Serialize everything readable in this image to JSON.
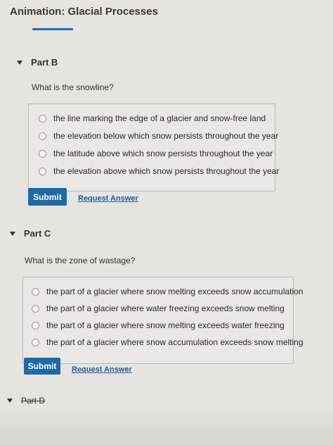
{
  "app": {
    "title": "Animation: Glacial Processes"
  },
  "parts": [
    {
      "label": "Part B",
      "question": "What is the snowline?",
      "choices": [
        "the line marking the edge of a glacier and snow-free land",
        "the elevation below which snow persists throughout the year",
        "the latitude above which snow persists throughout the year",
        "the elevation above which snow persists throughout the year"
      ],
      "submit_label": "Submit",
      "request_label": "Request Answer"
    },
    {
      "label": "Part C",
      "question": "What is the zone of wastage?",
      "choices": [
        "the part of a glacier where snow melting exceeds snow accumulation",
        "the part of a glacier where water freezing exceeds snow melting",
        "the part of a glacier where snow melting exceeds water freezing",
        "the part of a glacier where snow accumulation exceeds snow melting"
      ],
      "submit_label": "Submit",
      "request_label": "Request Answer"
    },
    {
      "label": "Part D"
    }
  ],
  "colors": {
    "accent": "#1e6aa8",
    "link": "#1f5f99",
    "background": "#e6e4df"
  }
}
